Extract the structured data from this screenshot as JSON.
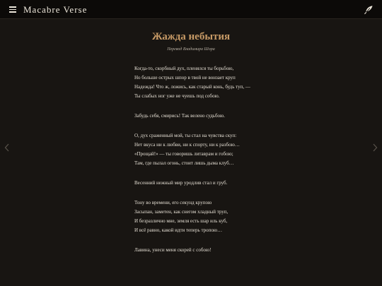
{
  "header": {
    "site_title": "Macabre Verse",
    "menu_icon": "hamburger-menu-icon",
    "feather_icon": "feather-quill-icon"
  },
  "poem": {
    "title": "Жажда небытия",
    "subtitle": "Перевод Владимира Шора",
    "stanzas": [
      {
        "lines": [
          "Когда-то, скорбный дух, пленялся ты борьбою,",
          "Но больше острых шпор в твой не вонзает круп",
          "Надежда! Что ж, ложись, как старый конь, будь туп, —",
          "Ты слабых ног уже не чуешь под собою."
        ]
      },
      {
        "lines": [
          "Забудь себя, смирись! Так велено судьбою."
        ]
      },
      {
        "lines": [
          "О, дух сраженный мой, ты стал на чувства скуп:",
          "Нет вкуса ни к любви, ни к спорту, ни к разбою…",
          "«Прощай!» — ты говоришь литаврам и гобою;",
          "Там, где пылал огонь, стоит лишь дыма клуб…"
        ]
      },
      {
        "lines": [
          "Весенний нежный мир уродлив стал и груб."
        ]
      },
      {
        "lines": [
          "Тону во времени, его секунд крупою",
          "Засыпан, заметен, как снегом хладный труп,",
          "И безразлично мне, земля есть шар иль куб,",
          "И всё равно, какой идти теперь тропою…"
        ]
      },
      {
        "lines": [
          "Лавина, унеси меня скорей с собою!"
        ]
      }
    ]
  },
  "navigation": {
    "prev_icon": "chevron-left-icon",
    "next_icon": "chevron-right-icon"
  },
  "colors": {
    "background": "#181512",
    "topbar": "#0c0a08",
    "title_accent": "#c79a66",
    "text": "#e4ded3"
  }
}
